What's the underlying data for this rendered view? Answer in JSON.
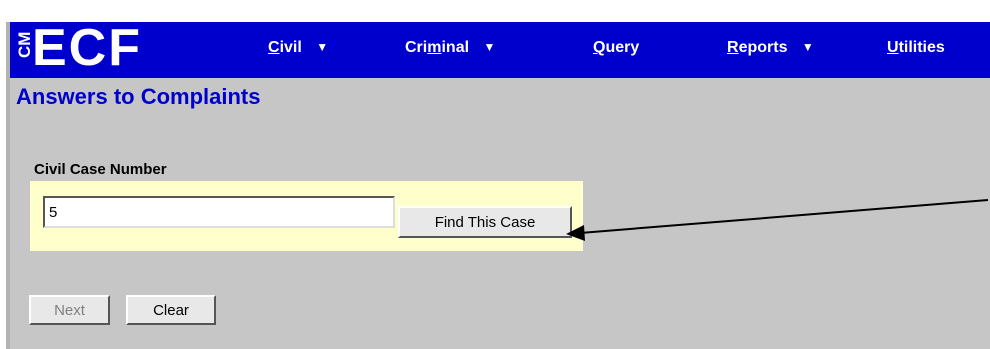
{
  "header": {
    "logo_cm": "CM",
    "logo_ecf": "ECF",
    "menu": [
      {
        "label_pre": "",
        "label_u": "C",
        "label_post": "ivil",
        "has_caret": true
      },
      {
        "label_pre": "Cri",
        "label_u": "m",
        "label_post": "inal",
        "has_caret": true
      },
      {
        "label_pre": "",
        "label_u": "Q",
        "label_post": "uery",
        "has_caret": false
      },
      {
        "label_pre": "",
        "label_u": "R",
        "label_post": "eports",
        "has_caret": true
      },
      {
        "label_pre": "",
        "label_u": "U",
        "label_post": "tilities",
        "has_caret": false
      }
    ],
    "caret": "▼"
  },
  "page": {
    "title": "Answers to Complaints"
  },
  "case_form": {
    "label": "Civil Case Number",
    "value": "5",
    "find_button": "Find This Case"
  },
  "actions": {
    "next_label": "Next",
    "clear_label": "Clear"
  },
  "colors": {
    "header_bg": "#0000cc",
    "title_color": "#0000cc",
    "page_bg": "#c6c6c6",
    "panel_bg": "#ffffcc"
  }
}
